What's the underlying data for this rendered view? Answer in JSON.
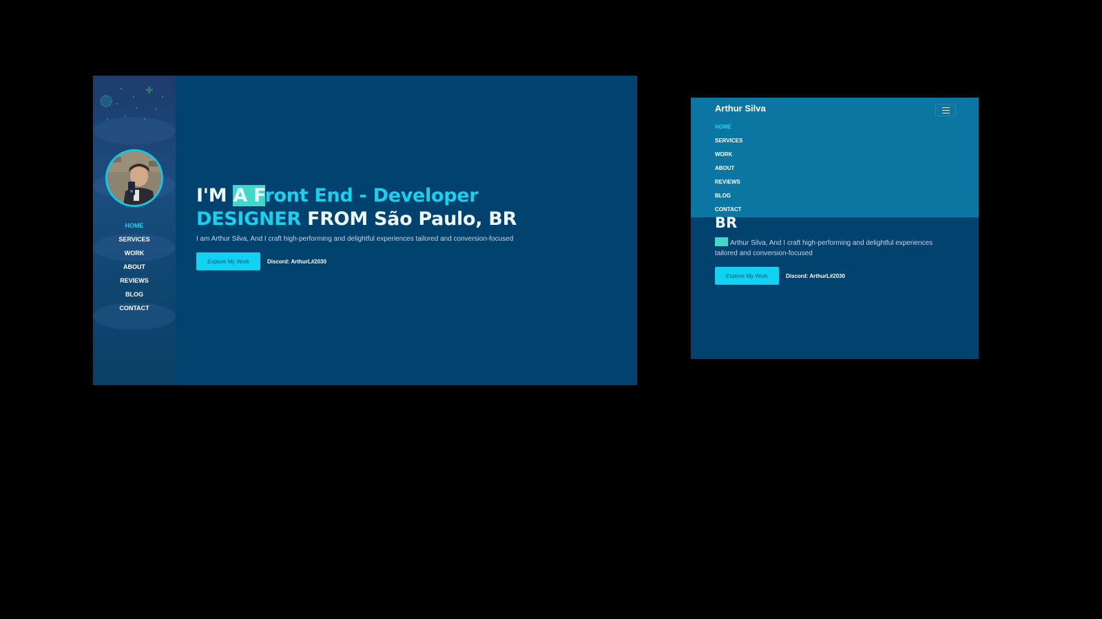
{
  "desktop": {
    "nav": [
      {
        "label": "HOME",
        "active": true
      },
      {
        "label": "SERVICES",
        "active": false
      },
      {
        "label": "WORK",
        "active": false
      },
      {
        "label": "ABOUT",
        "active": false
      },
      {
        "label": "REVIEWS",
        "active": false
      },
      {
        "label": "BLOG",
        "active": false
      },
      {
        "label": "CONTACT",
        "active": false
      }
    ],
    "hero": {
      "line1_prefix": "I'M ",
      "line1_selected": "A F",
      "line1_rest": "ront End - Developer",
      "line2_accent": "DESIGNER",
      "line2_rest": " FROM São Paulo, BR",
      "description": "I am Arthur Silva, And I craft high-performing and delightful experiences tailored and conversion-focused",
      "cta_label": "Explore My Work",
      "discord": "Discord: ArthurL#2030"
    }
  },
  "mobile": {
    "brand": "Arthur Silva",
    "nav": [
      {
        "label": "HOME",
        "active": true
      },
      {
        "label": "SERVICES",
        "active": false
      },
      {
        "label": "WORK",
        "active": false
      },
      {
        "label": "ABOUT",
        "active": false
      },
      {
        "label": "REVIEWS",
        "active": false
      },
      {
        "label": "BLOG",
        "active": false
      },
      {
        "label": "CONTACT",
        "active": false
      }
    ],
    "hero": {
      "heading_tail": "BR",
      "description": "Arthur Silva, And I craft high-performing and delightful experiences tailored and conversion-focused",
      "cta_label": "Explore My Work",
      "discord": "Discord: ArthurL#2030"
    }
  },
  "icons": [
    "gear-icon",
    "plus-icon",
    "hamburger-icon"
  ],
  "colors": {
    "background": "#000000",
    "page": "#02426e",
    "sidebar": "#1b4d7e",
    "accent": "#16d2ee",
    "selection": "#3fd9cc",
    "mobile_menu": "#0a76a1"
  }
}
